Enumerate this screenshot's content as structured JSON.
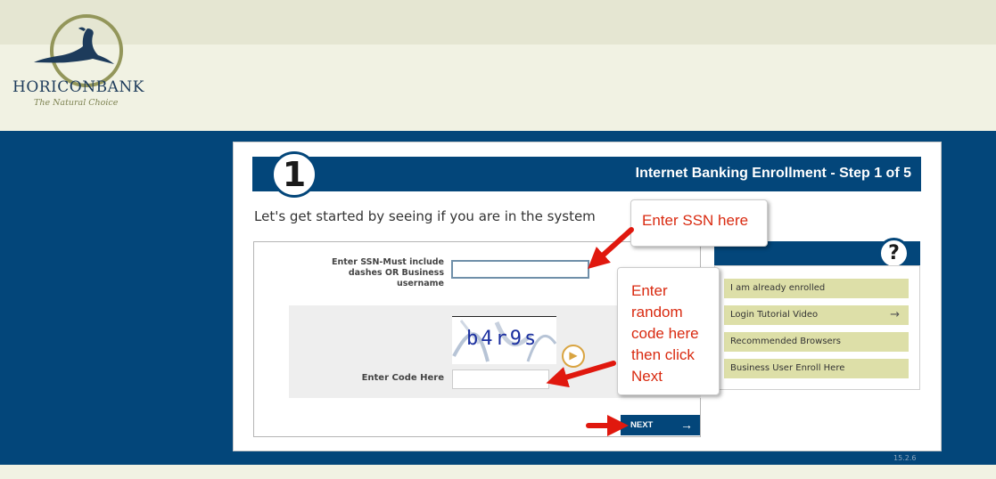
{
  "brand": {
    "name_horicon": "HORICON",
    "name_bank": "BANK",
    "tagline": "The Natural Choice"
  },
  "enrollment": {
    "step_number": "1",
    "title": "Internet Banking Enrollment - Step 1 of 5",
    "subtitle": "Let's get started by seeing if you are in the system"
  },
  "form": {
    "ssn_label": "Enter SSN-Must include dashes OR Business username",
    "ssn_value": "",
    "captcha_text": "b4r9s",
    "code_label": "Enter Code Here",
    "code_value": "",
    "next_label": "NEXT",
    "next_arrow": "→"
  },
  "help": {
    "icon": "?",
    "links": [
      {
        "label": "I am already enrolled",
        "arrow": ""
      },
      {
        "label": "Login Tutorial Video",
        "arrow": "→"
      },
      {
        "label": "Recommended Browsers",
        "arrow": ""
      },
      {
        "label": "Business User Enroll Here",
        "arrow": ""
      }
    ]
  },
  "annotations": {
    "ssn_callout": "Enter SSN here",
    "code_callout": "Enter random code here then click Next"
  },
  "version": "15.2.6",
  "colors": {
    "navy": "#03467a",
    "header_bg": "#f1f2e3",
    "olive": "#93965a",
    "help_link_bg": "#dddfa8",
    "callout_text": "#d92a10"
  }
}
